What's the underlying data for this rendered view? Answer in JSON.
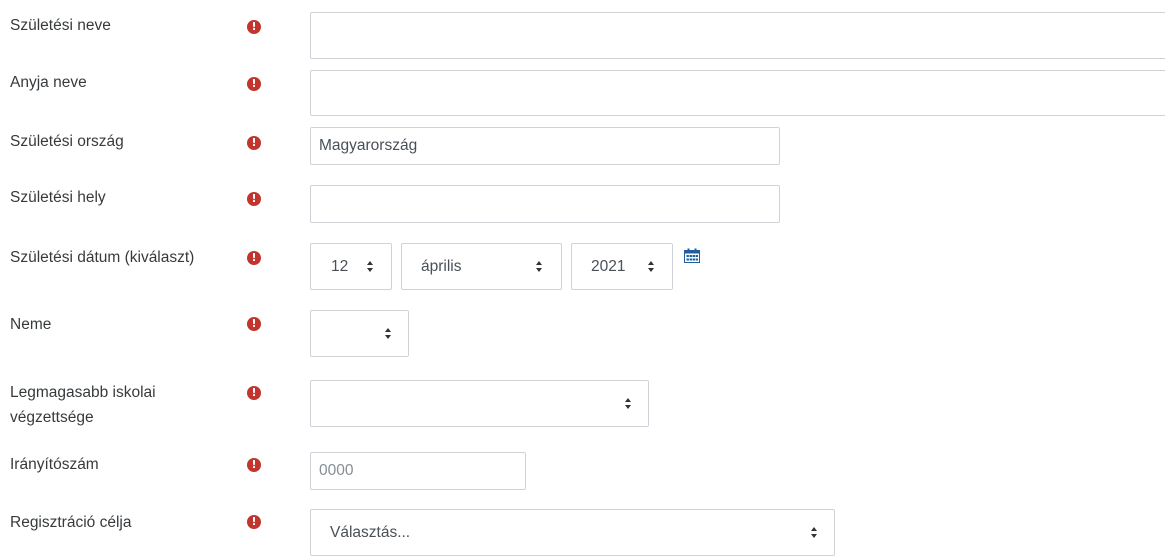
{
  "form": {
    "birth_name": {
      "label": "Születési neve",
      "value": ""
    },
    "mother_name": {
      "label": "Anyja neve",
      "value": ""
    },
    "birth_country": {
      "label": "Születési ország",
      "value": "Magyarország"
    },
    "birth_place": {
      "label": "Születési hely",
      "value": ""
    },
    "birth_date": {
      "label": "Születési dátum (kiválaszt)",
      "day": "12",
      "month": "április",
      "year": "2021"
    },
    "gender": {
      "label": "Neme",
      "value": ""
    },
    "education": {
      "label_line1": "Legmagasabb iskolai",
      "label_line2": "végzettsége",
      "value": ""
    },
    "postcode": {
      "label": "Irányítószám",
      "placeholder": "0000"
    },
    "purpose": {
      "label": "Regisztráció célja",
      "value": "Választás..."
    }
  },
  "icons": {
    "required": "exclamation-circle-icon",
    "calendar": "calendar-icon",
    "select_caret": "updown-caret-icon"
  },
  "colors": {
    "required": "#c0352d",
    "calendar": "#1f5f9e",
    "border": "#cfd3d7",
    "label": "#373a3c"
  },
  "required_mark": "!"
}
